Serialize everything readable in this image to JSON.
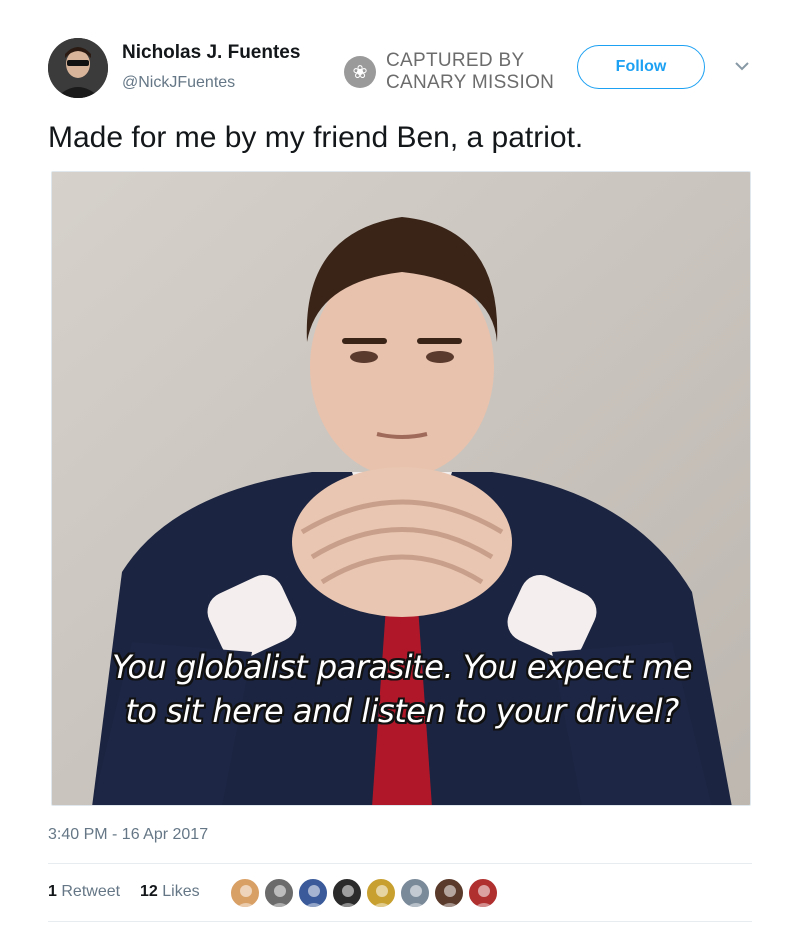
{
  "user": {
    "name": "Nicholas J. Fuentes",
    "handle": "@NickJFuentes"
  },
  "watermark": {
    "line1": "CAPTURED BY",
    "line2": "CANARY MISSION"
  },
  "follow_label": "Follow",
  "tweet": {
    "text": "Made for me by my friend Ben, a patriot.",
    "caption_line1": "You globalist parasite. You expect me",
    "caption_line2": "to sit here and listen to your drivel?",
    "timestamp": "3:40 PM - 16 Apr 2017"
  },
  "stats": {
    "retweets_count": "1",
    "retweets_label": "Retweet",
    "likes_count": "12",
    "likes_label": "Likes"
  },
  "liker_avatars": [
    {
      "color": "#d9a066",
      "icon": "avatar"
    },
    {
      "color": "#6b6b6b",
      "icon": "avatar"
    },
    {
      "color": "#3a5a9a",
      "icon": "avatar"
    },
    {
      "color": "#2b2b2b",
      "icon": "avatar"
    },
    {
      "color": "#c8a030",
      "icon": "avatar"
    },
    {
      "color": "#7a8a99",
      "icon": "avatar"
    },
    {
      "color": "#5a3a2a",
      "icon": "avatar"
    },
    {
      "color": "#b03030",
      "icon": "avatar"
    }
  ],
  "colors": {
    "accent": "#1da1f2",
    "muted": "#657786"
  }
}
